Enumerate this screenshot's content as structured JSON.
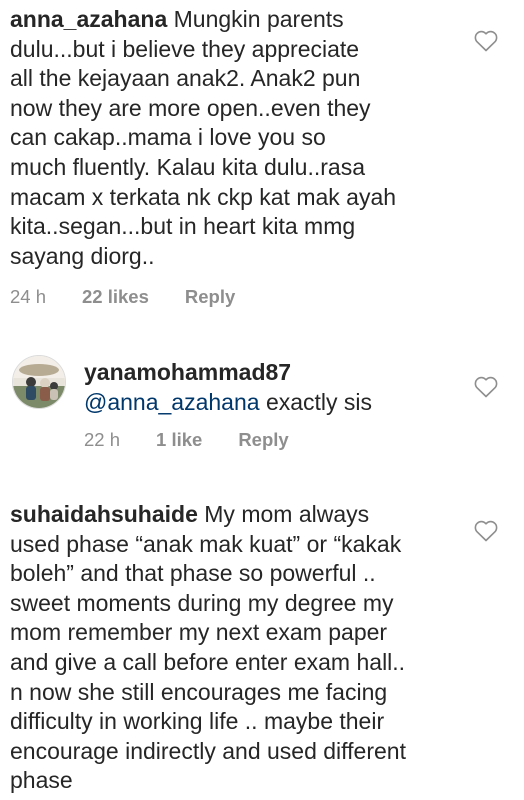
{
  "comments": [
    {
      "username": "anna_azahana",
      "lines": [
        "Mungkin parents",
        "dulu...but i believe they appreciate",
        "all the kejayaan anak2. Anak2 pun",
        "now they are more open..even they",
        "can cakap..mama i love you so",
        "much fluently. Kalau kita dulu..rasa",
        "macam x terkata nk ckp kat mak ayah",
        "kita..segan...but in heart kita mmg",
        "sayang diorg.."
      ],
      "time": "24 h",
      "likes": "22 likes",
      "reply": "Reply"
    },
    {
      "username": "yanamohammad87",
      "mention": "@anna_azahana",
      "text": "exactly sis",
      "time": "22 h",
      "likes": "1 like",
      "reply": "Reply"
    },
    {
      "username": "suhaidahsuhaide",
      "lines": [
        "My mom always",
        "used phase “anak mak kuat” or “kakak",
        "boleh” and that phase so powerful ..",
        "sweet moments during my degree my",
        "mom remember my next exam paper",
        "and give a call before enter exam hall..",
        "n now she still encourages me facing",
        "difficulty in working life .. maybe their",
        "encourage indirectly  and used different",
        "phase"
      ]
    }
  ],
  "icons": {
    "like": "heart-outline-icon",
    "avatar": "user-avatar"
  },
  "colors": {
    "text": "#262626",
    "meta": "#8e8e8e",
    "mention": "#00376b",
    "icon": "#8e8e8e"
  }
}
